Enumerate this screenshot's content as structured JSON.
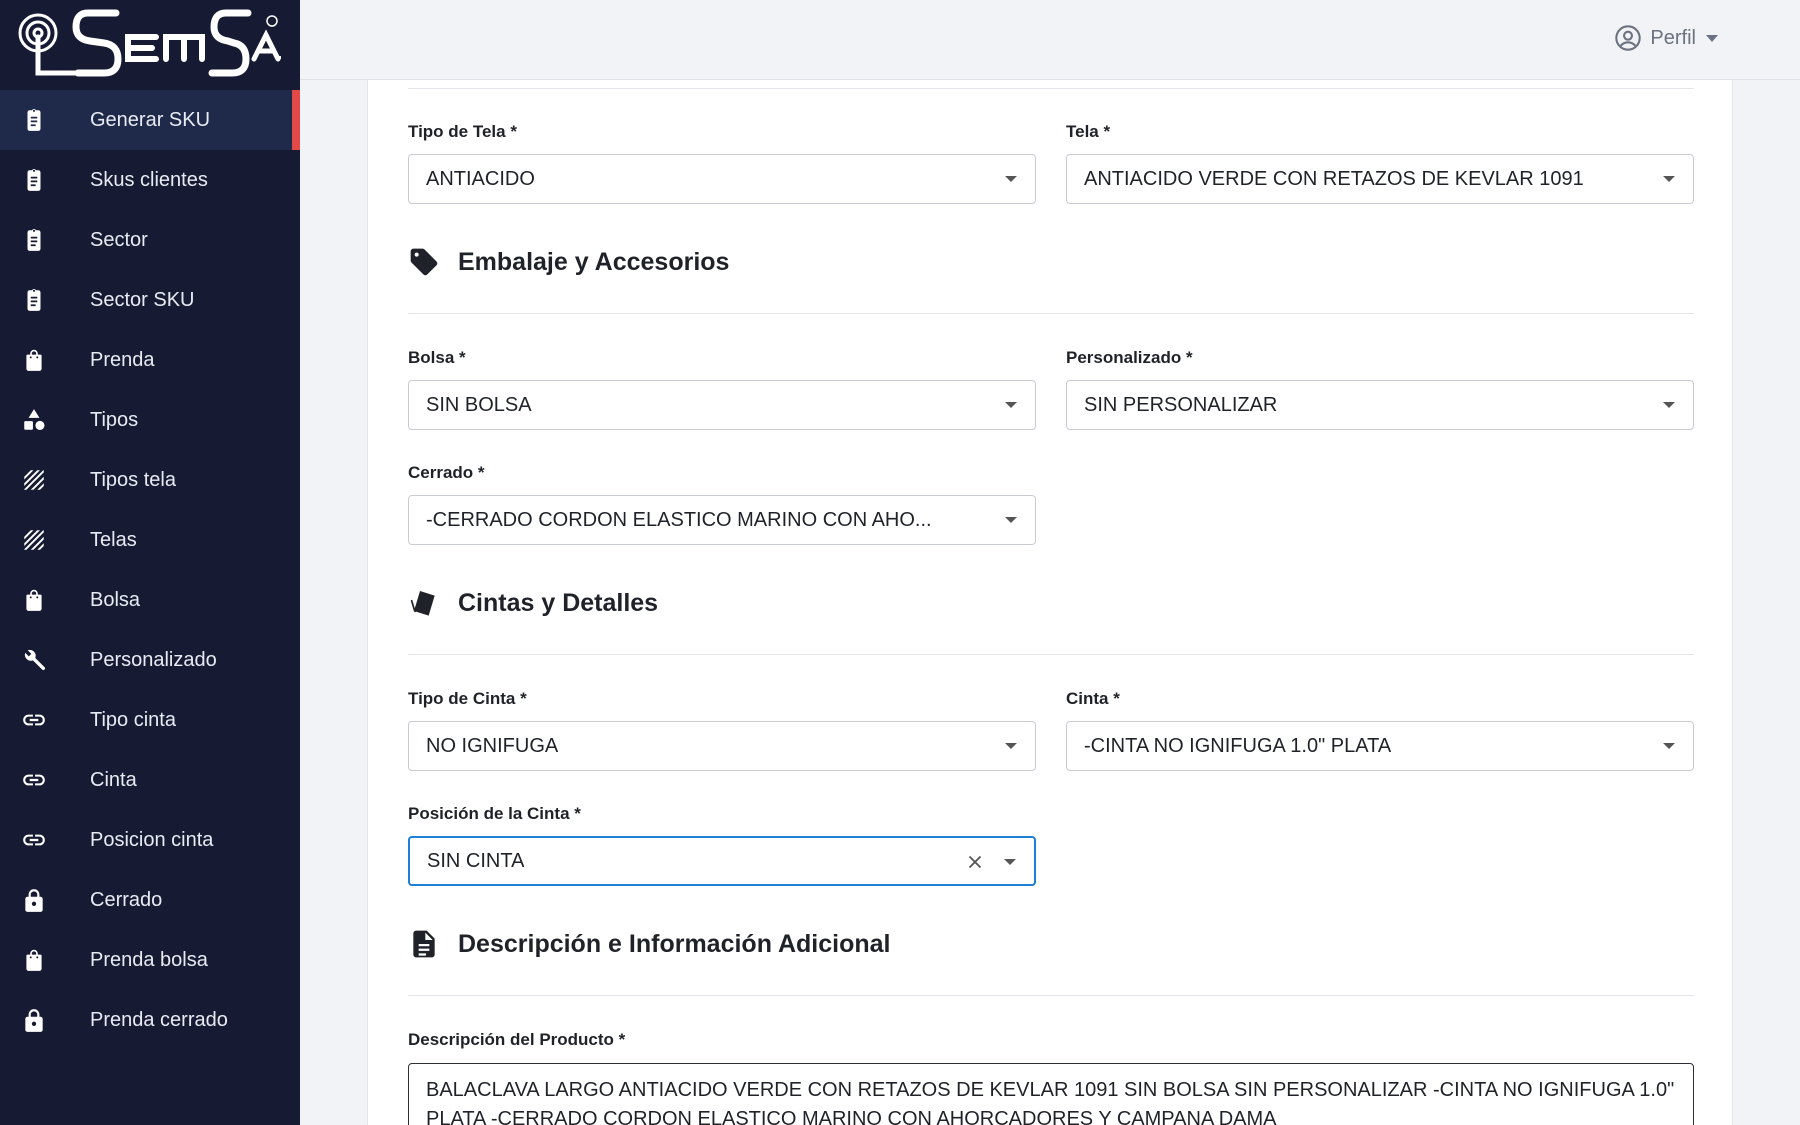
{
  "brand": {
    "logo_text": "SEMSA"
  },
  "sidebar": {
    "items": [
      {
        "label": "Generar SKU",
        "icon": "clipboard-icon",
        "active": true
      },
      {
        "label": "Skus clientes",
        "icon": "clipboard-icon"
      },
      {
        "label": "Sector",
        "icon": "clipboard-icon"
      },
      {
        "label": "Sector SKU",
        "icon": "clipboard-icon"
      },
      {
        "label": "Prenda",
        "icon": "shopping-bag-icon"
      },
      {
        "label": "Tipos",
        "icon": "shapes-icon"
      },
      {
        "label": "Tipos tela",
        "icon": "hatch-icon"
      },
      {
        "label": "Telas",
        "icon": "hatch-icon"
      },
      {
        "label": "Bolsa",
        "icon": "shopping-bag-icon"
      },
      {
        "label": "Personalizado",
        "icon": "wrench-icon"
      },
      {
        "label": "Tipo cinta",
        "icon": "link-icon"
      },
      {
        "label": "Cinta",
        "icon": "link-icon"
      },
      {
        "label": "Posicion cinta",
        "icon": "link-icon"
      },
      {
        "label": "Cerrado",
        "icon": "lock-icon"
      },
      {
        "label": "Prenda bolsa",
        "icon": "shopping-bag-icon"
      },
      {
        "label": "Prenda cerrado",
        "icon": "lock-icon"
      }
    ]
  },
  "header": {
    "profile_label": "Perfil"
  },
  "form": {
    "tipo_tela": {
      "label": "Tipo de Tela *",
      "value": "ANTIACIDO"
    },
    "tela": {
      "label": "Tela *",
      "value": "ANTIACIDO VERDE CON RETAZOS DE KEVLAR 1091"
    },
    "section_embalaje": {
      "title": "Embalaje y Accesorios",
      "icon": "tag-icon"
    },
    "bolsa": {
      "label": "Bolsa *",
      "value": "SIN BOLSA"
    },
    "personalizado": {
      "label": "Personalizado *",
      "value": "SIN PERSONALIZAR"
    },
    "cerrado": {
      "label": "Cerrado *",
      "value": "-CERRADO CORDON ELASTICO MARINO CON AHO..."
    },
    "section_cintas": {
      "title": "Cintas y Detalles",
      "icon": "swatches-icon"
    },
    "tipo_cinta": {
      "label": "Tipo de Cinta *",
      "value": "NO IGNIFUGA"
    },
    "cinta": {
      "label": "Cinta *",
      "value": "-CINTA NO IGNIFUGA 1.0\" PLATA"
    },
    "posicion_cinta": {
      "label": "Posición de la Cinta *",
      "value": "SIN CINTA"
    },
    "section_descripcion": {
      "title": "Descripción e Información Adicional",
      "icon": "document-icon"
    },
    "descripcion": {
      "label": "Descripción del Producto *",
      "value": "BALACLAVA LARGO ANTIACIDO VERDE CON RETAZOS DE KEVLAR 1091 SIN BOLSA SIN PERSONALIZAR -CINTA NO IGNIFUGA 1.0\" PLATA -CERRADO CORDON ELASTICO MARINO CON AHORCADORES Y CAMPANA DAMA"
    }
  },
  "colors": {
    "sidebar_bg": "#161b33",
    "active_indicator": "#e24a4a",
    "focus_border": "#1f7ed8"
  }
}
